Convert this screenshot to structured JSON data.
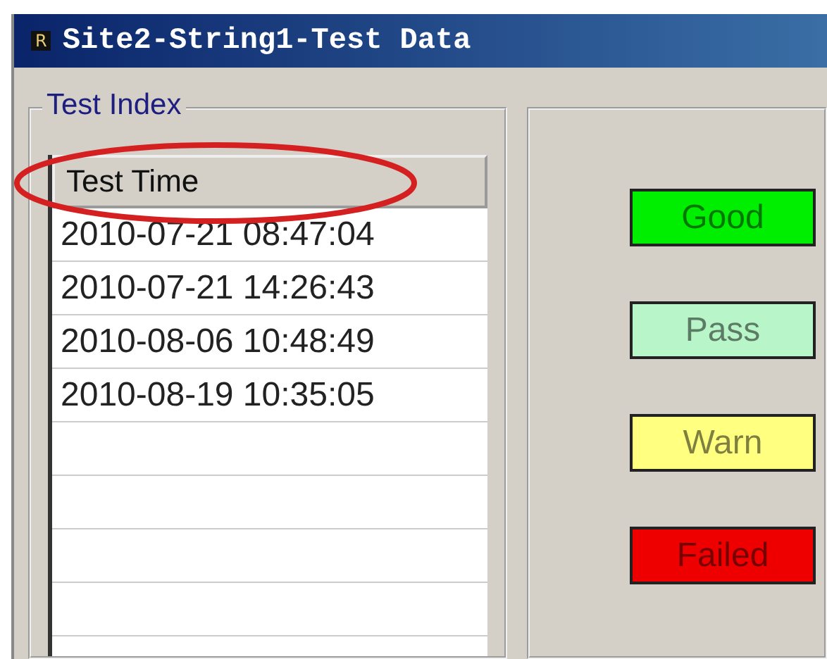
{
  "window": {
    "title": "Site2-String1-Test Data",
    "icon_letter": "R"
  },
  "test_index": {
    "label": "Test Index",
    "column": "Test Time",
    "rows": [
      "2010-07-21 08:47:04",
      "2010-07-21 14:26:43",
      "2010-08-06 10:48:49",
      "2010-08-19 10:35:05"
    ]
  },
  "legend": [
    {
      "label": "Good",
      "color": "#00ee00"
    },
    {
      "label": "Pass",
      "color": "#b8f5c8"
    },
    {
      "label": "Warn",
      "color": "#ffff80"
    },
    {
      "label": "Failed",
      "color": "#ee0000"
    }
  ]
}
